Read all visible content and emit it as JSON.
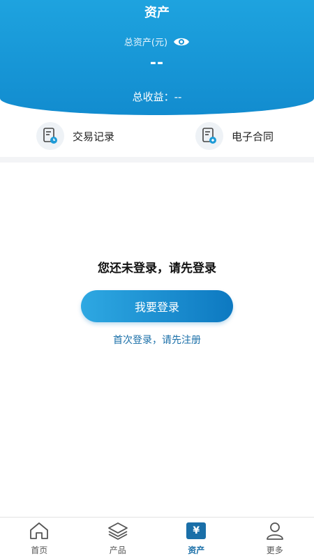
{
  "header": {
    "title": "资产",
    "total_assets_label": "总资产(元)",
    "total_assets_value": "--",
    "total_earnings_label": "总收益：--"
  },
  "quick_actions": [
    {
      "label": "交易记录",
      "icon": "transaction-record-icon"
    },
    {
      "label": "电子合同",
      "icon": "e-contract-icon"
    }
  ],
  "login": {
    "prompt": "您还未登录，请先登录",
    "button_label": "我要登录",
    "register_link": "首次登录，请先注册"
  },
  "tabbar": {
    "active_index": 2,
    "items": [
      {
        "label": "首页",
        "icon": "home-icon"
      },
      {
        "label": "产品",
        "icon": "layers-icon"
      },
      {
        "label": "资产",
        "icon": "yuan-icon",
        "glyph": "¥"
      },
      {
        "label": "更多",
        "icon": "user-icon"
      }
    ]
  },
  "colors": {
    "header_gradient_top": "#1ea3df",
    "header_gradient_bottom": "#128ccf",
    "accent": "#1a6fa8",
    "button_gradient_start": "#2ea8e2",
    "button_gradient_end": "#0d79c1"
  }
}
